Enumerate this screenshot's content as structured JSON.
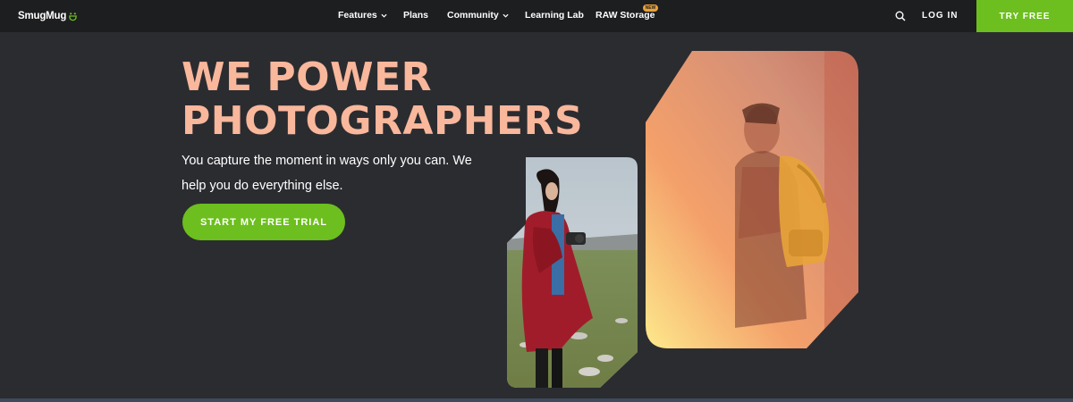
{
  "nav": {
    "logo": "SmugMug",
    "items": [
      {
        "label": "Features",
        "dropdown": true
      },
      {
        "label": "Plans",
        "dropdown": false
      },
      {
        "label": "Community",
        "dropdown": true
      },
      {
        "label": "Learning Lab",
        "dropdown": false
      },
      {
        "label": "RAW Storage",
        "dropdown": false,
        "badge": "NEW"
      }
    ],
    "login": "LOG IN",
    "try_free": "TRY FREE"
  },
  "hero": {
    "headline_line1": "WE POWER",
    "headline_line2": "PHOTOGRAPHERS",
    "subtext": "You capture the moment in ways only you can. We help you do everything else.",
    "cta": "START MY FREE TRIAL"
  },
  "icons": {
    "logo": "smile-icon",
    "dropdown": "chevron-down-icon",
    "search": "search-icon"
  },
  "colors": {
    "background": "#2b2c30",
    "navbar": "#1d1e20",
    "accent_green": "#6cbf1e",
    "headline_peach": "#f9b79c",
    "badge": "#e8a23b"
  }
}
